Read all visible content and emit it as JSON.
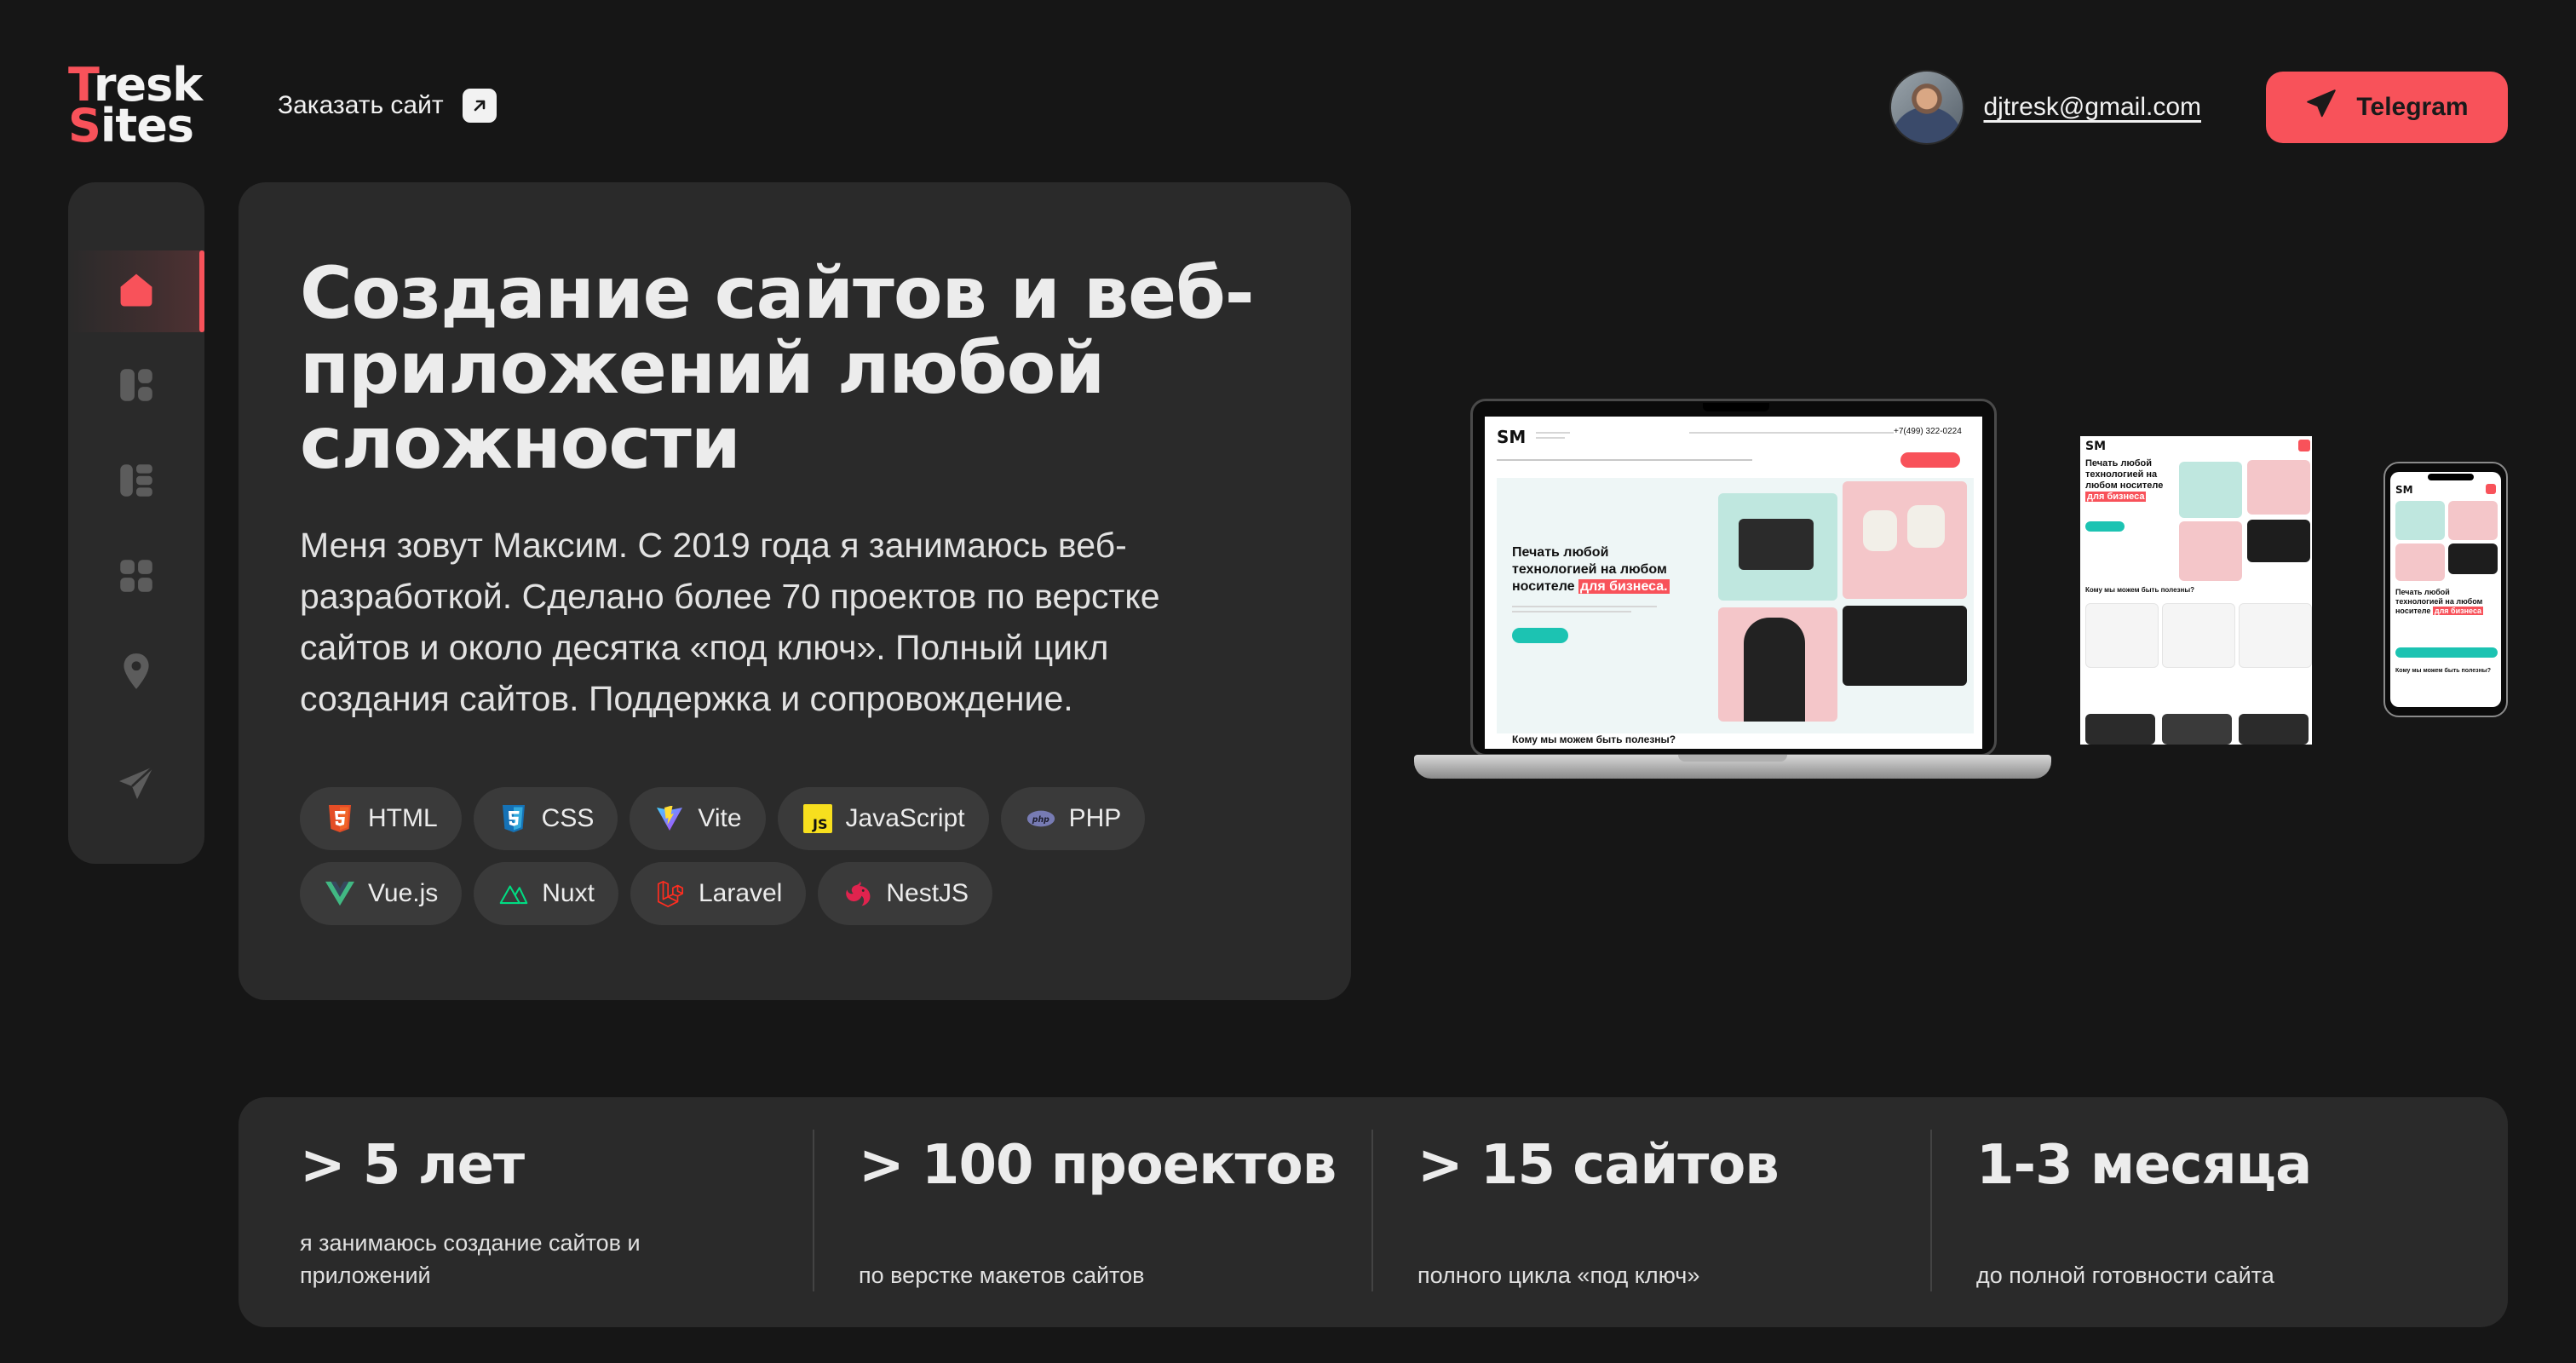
{
  "logo": {
    "line1_accent": "T",
    "line1_rest": "resk",
    "line2_accent": "S",
    "line2_rest": "ites"
  },
  "header": {
    "order_label": "Заказать сайт",
    "email": "djtresk@gmail.com",
    "telegram_label": "Telegram"
  },
  "sidebar": {
    "items": [
      {
        "icon": "home-icon",
        "active": true
      },
      {
        "icon": "layout-icon",
        "active": false
      },
      {
        "icon": "list-icon",
        "active": false
      },
      {
        "icon": "grid-icon",
        "active": false
      },
      {
        "icon": "location-pin-icon",
        "active": false
      },
      {
        "icon": "send-icon",
        "active": false
      }
    ]
  },
  "hero": {
    "title": "Создание сайтов и веб-приложений любой сложности",
    "description": "Меня зовут Максим. С 2019 года я занимаюсь веб-разработкой. Сделано более 70 проектов по верстке сайтов и около десятка «под ключ». Полный цикл создания сайтов. Поддержка и сопровождение.",
    "tags": [
      {
        "label": "HTML",
        "icon": "html5-icon"
      },
      {
        "label": "CSS",
        "icon": "css3-icon"
      },
      {
        "label": "Vite",
        "icon": "vite-icon"
      },
      {
        "label": "JavaScript",
        "icon": "javascript-icon"
      },
      {
        "label": "PHP",
        "icon": "php-icon"
      },
      {
        "label": "Vue.js",
        "icon": "vue-icon"
      },
      {
        "label": "Nuxt",
        "icon": "nuxt-icon"
      },
      {
        "label": "Laravel",
        "icon": "laravel-icon"
      },
      {
        "label": "NestJS",
        "icon": "nestjs-icon"
      }
    ]
  },
  "mockup": {
    "logo": "SM",
    "headline_1": "Печать любой",
    "headline_2": "технологией на любом",
    "headline_3": "носителе",
    "headline_hl": "для бизнеса.",
    "section_title": "Кому мы можем быть полезны?",
    "phone_number": "+7(499) 322-0224"
  },
  "stats": [
    {
      "value": "> 5 лет",
      "label": "я занимаюсь создание сайтов и приложений"
    },
    {
      "value": "> 100 проектов",
      "label": "по верстке макетов сайтов"
    },
    {
      "value": "> 15 сайтов",
      "label": "полного цикла «под ключ»"
    },
    {
      "value": "1-3 месяца",
      "label": "до полной готовности сайта"
    }
  ],
  "colors": {
    "accent": "#f8525a",
    "background": "#161616",
    "card": "#2a2a2a",
    "chip": "#3a3a3a"
  }
}
